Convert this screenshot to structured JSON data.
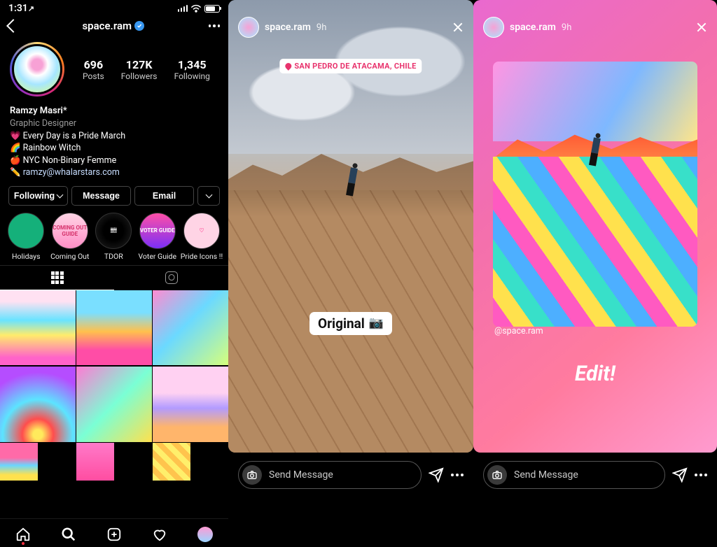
{
  "status": {
    "time": "1:31",
    "arrow": "↗"
  },
  "header": {
    "username": "space.ram"
  },
  "profile": {
    "stats": [
      {
        "n": "696",
        "l": "Posts"
      },
      {
        "n": "127K",
        "l": "Followers"
      },
      {
        "n": "1,345",
        "l": "Following"
      }
    ],
    "name": "Ramzy Masri*",
    "category": "Graphic Designer",
    "bio_lines": [
      "💗 Every Day is a Pride March",
      "🌈 Rainbow Witch",
      "🍎 NYC Non-Binary Femme"
    ],
    "link_emoji": "✏️",
    "link": "ramzy@whalarstars.com"
  },
  "buttons": {
    "following": "Following",
    "message": "Message",
    "email": "Email"
  },
  "highlights": [
    {
      "label": "Holidays",
      "inner": ""
    },
    {
      "label": "Coming Out",
      "inner": "COMING OUT GUIDE"
    },
    {
      "label": "TDOR",
      "inner": "🕯🕯🕯🕯"
    },
    {
      "label": "Voter Guide",
      "inner": "VOTER GUIDE"
    },
    {
      "label": "Pride Icons !!",
      "inner": "♡"
    }
  ],
  "story_left": {
    "username": "space.ram",
    "time": "9h",
    "location": "SAN PEDRO DE ATACAMA, CHILE",
    "tag": "Original",
    "send_placeholder": "Send Message"
  },
  "story_right": {
    "username": "space.ram",
    "time": "9h",
    "mention": "@space.ram",
    "edit_label": "Edit!",
    "send_placeholder": "Send Message"
  }
}
